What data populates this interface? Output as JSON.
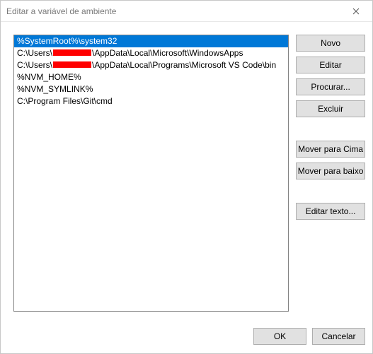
{
  "titlebar": {
    "title": "Editar a variável de ambiente"
  },
  "list": {
    "items": [
      {
        "prefix": "%SystemRoot%\\system32",
        "redacted": false,
        "suffix": "",
        "selected": true
      },
      {
        "prefix": "C:\\Users\\",
        "redacted": true,
        "suffix": "\\AppData\\Local\\Microsoft\\WindowsApps",
        "selected": false
      },
      {
        "prefix": "C:\\Users\\",
        "redacted": true,
        "suffix": "\\AppData\\Local\\Programs\\Microsoft VS Code\\bin",
        "selected": false
      },
      {
        "prefix": "%NVM_HOME%",
        "redacted": false,
        "suffix": "",
        "selected": false
      },
      {
        "prefix": "%NVM_SYMLINK%",
        "redacted": false,
        "suffix": "",
        "selected": false
      },
      {
        "prefix": "C:\\Program Files\\Git\\cmd",
        "redacted": false,
        "suffix": "",
        "selected": false
      }
    ]
  },
  "sidebar": {
    "new": "Novo",
    "edit": "Editar",
    "browse": "Procurar...",
    "delete": "Excluir",
    "move_up": "Mover para Cima",
    "move_down": "Mover para baixo",
    "edit_text": "Editar texto..."
  },
  "footer": {
    "ok": "OK",
    "cancel": "Cancelar"
  }
}
